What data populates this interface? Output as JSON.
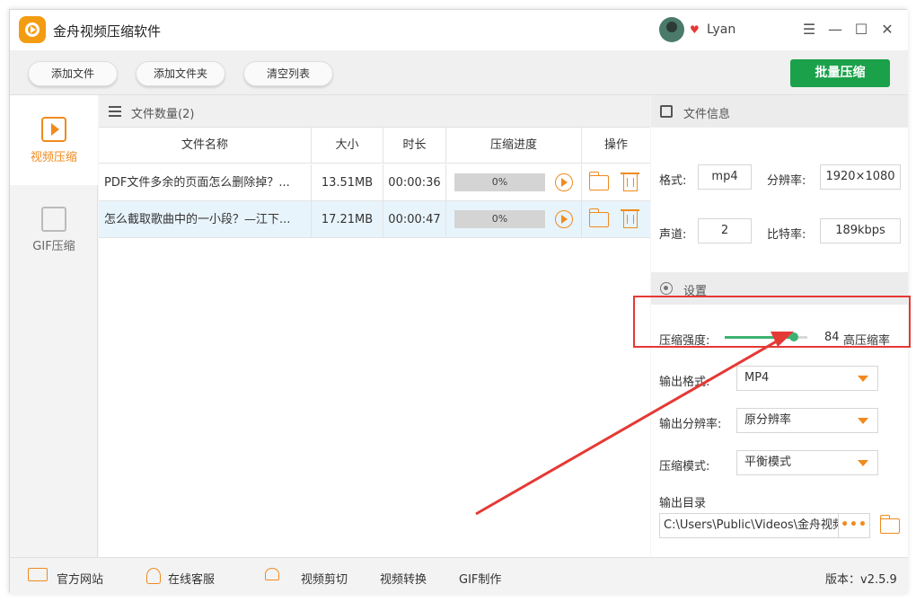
{
  "app": {
    "title": "金舟视频压缩软件"
  },
  "user": {
    "name": "Lyan"
  },
  "window_controls": {
    "menu": "☰",
    "minimize": "—",
    "maximize": "☐",
    "close": "✕"
  },
  "toolbar": {
    "add_file": "添加文件",
    "add_folder": "添加文件夹",
    "clear_list": "清空列表",
    "batch_compress": "批量压缩"
  },
  "sidebar": {
    "items": [
      {
        "label": "视频压缩",
        "active": true
      },
      {
        "label": "GIF压缩",
        "active": false
      }
    ]
  },
  "file_list": {
    "header": "文件数量(2)",
    "columns": [
      "文件名称",
      "大小",
      "时长",
      "压缩进度",
      "操作"
    ],
    "rows": [
      {
        "name": "PDF文件多余的页面怎么删除掉？...",
        "size": "13.51MB",
        "duration": "00:00:36",
        "progress": "0%"
      },
      {
        "name": "怎么截取歌曲中的一小段？—江下...",
        "size": "17.21MB",
        "duration": "00:00:47",
        "progress": "0%"
      }
    ]
  },
  "file_info": {
    "header": "文件信息",
    "format_label": "格式:",
    "format": "mp4",
    "resolution_label": "分辨率:",
    "resolution": "1920×1080",
    "channel_label": "声道:",
    "channel": "2",
    "bitrate_label": "比特率:",
    "bitrate": "189kbps"
  },
  "settings": {
    "header": "设置",
    "strength_label": "压缩强度:",
    "strength_value": "84",
    "strength_fraction": 0.84,
    "strength_desc": "高压缩率",
    "output_format_label": "输出格式:",
    "output_format": "MP4",
    "output_resolution_label": "输出分辨率:",
    "output_resolution": "原分辨率",
    "mode_label": "压缩模式:",
    "mode": "平衡模式",
    "output_dir_label": "输出目录",
    "output_dir": "C:\\Users\\Public\\Videos\\金舟视频压缩",
    "browse": "•••"
  },
  "footer": {
    "website": "官方网站",
    "support": "在线客服",
    "video_cut": "视频剪切",
    "video_convert": "视频转换",
    "gif_make": "GIF制作",
    "version": "版本：v2.5.9"
  },
  "colors": {
    "accent": "#f08a1e",
    "primary": "#1aa14a",
    "highlight": "#e53935"
  }
}
